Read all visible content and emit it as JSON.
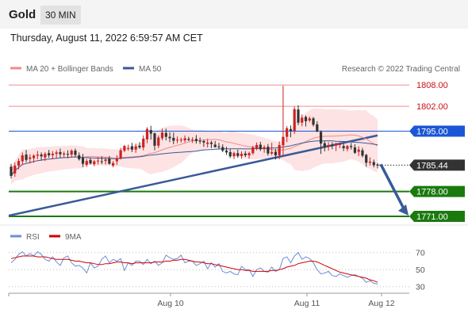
{
  "header": {
    "symbol": "Gold",
    "timeframe": "30 MIN",
    "timestamp": "Thursday, August 11, 2022 6:59:57 AM CET"
  },
  "legend": {
    "ma20_label": "MA 20 + Bollinger Bands",
    "ma50_label": "MA 50",
    "copyright": "Research © 2022 Trading Central",
    "rsi_label": "RSI",
    "rsi_ma_label": "9MA"
  },
  "colors": {
    "candle_up": "#cc2222",
    "candle_down": "#333333",
    "resistance": "#f08c8c",
    "pivot": "#1a56d6",
    "support": "#1a7a0e",
    "trend": "#3a5a98",
    "band_fill": "#fde3e3",
    "ma20": "#f08c8c",
    "ma50": "#3a5a98",
    "rsi": "#6a8fd8",
    "rsi_ma": "#d00000"
  },
  "chart_data": [
    {
      "type": "candlestick",
      "title": "Gold",
      "timeframe": "30 MIN",
      "ylim": [
        1769,
        1810.5
      ],
      "x_ticks": [
        "Aug 10",
        "Aug 11",
        "Aug 12"
      ],
      "last_price": 1785.44,
      "levels": [
        {
          "value": 1808.0,
          "label": "1808.00",
          "kind": "resistance"
        },
        {
          "value": 1802.0,
          "label": "1802.00",
          "kind": "resistance"
        },
        {
          "value": 1795.0,
          "label": "1795.00",
          "kind": "pivot"
        },
        {
          "value": 1785.44,
          "label": "1785.44",
          "kind": "last"
        },
        {
          "value": 1778.0,
          "label": "1778.00",
          "kind": "support"
        },
        {
          "value": 1771.0,
          "label": "1771.00",
          "kind": "support"
        }
      ],
      "trendline": [
        [
          0,
          1771.2
        ],
        [
          97,
          1793.8
        ]
      ],
      "forecast_target": 1771.0,
      "candles": [
        [
          1785.0,
          1785.8,
          1781.7,
          1782.4
        ],
        [
          1783.1,
          1786.2,
          1782.1,
          1785.3
        ],
        [
          1785.3,
          1787.3,
          1784.2,
          1786.6
        ],
        [
          1786.5,
          1789.0,
          1785.6,
          1788.2
        ],
        [
          1788.4,
          1789.7,
          1786.2,
          1786.9
        ],
        [
          1787.2,
          1788.5,
          1785.9,
          1787.6
        ],
        [
          1787.4,
          1788.5,
          1786.1,
          1788.1
        ],
        [
          1788.1,
          1789.4,
          1787.1,
          1788.4
        ],
        [
          1788.4,
          1789.0,
          1786.8,
          1787.9
        ],
        [
          1787.6,
          1789.1,
          1786.6,
          1788.6
        ],
        [
          1788.8,
          1789.7,
          1787.5,
          1788.2
        ],
        [
          1788.2,
          1789.4,
          1787.1,
          1788.6
        ],
        [
          1788.6,
          1789.6,
          1787.5,
          1789.0
        ],
        [
          1789.1,
          1790.1,
          1787.6,
          1788.5
        ],
        [
          1788.4,
          1789.3,
          1787.5,
          1788.7
        ],
        [
          1788.6,
          1789.6,
          1787.4,
          1788.4
        ],
        [
          1788.4,
          1789.9,
          1787.6,
          1789.5
        ],
        [
          1789.5,
          1790.1,
          1787.8,
          1788.3
        ],
        [
          1788.2,
          1789.0,
          1786.7,
          1787.1
        ],
        [
          1787.5,
          1788.6,
          1784.9,
          1785.8
        ],
        [
          1785.5,
          1787.2,
          1784.9,
          1786.6
        ],
        [
          1786.9,
          1787.5,
          1785.6,
          1785.9
        ],
        [
          1785.7,
          1786.9,
          1785.1,
          1786.5
        ],
        [
          1786.7,
          1787.7,
          1785.6,
          1786.7
        ],
        [
          1786.5,
          1787.9,
          1785.7,
          1786.4
        ],
        [
          1786.6,
          1787.6,
          1785.6,
          1787.0
        ],
        [
          1787.2,
          1788.0,
          1785.6,
          1785.8
        ],
        [
          1785.3,
          1786.6,
          1784.8,
          1786.0
        ],
        [
          1786.5,
          1788.2,
          1785.5,
          1787.2
        ],
        [
          1787.4,
          1790.3,
          1787.0,
          1789.6
        ],
        [
          1789.5,
          1791.1,
          1789.1,
          1790.8
        ],
        [
          1790.2,
          1791.2,
          1789.5,
          1790.2
        ],
        [
          1790.7,
          1791.7,
          1789.1,
          1789.8
        ],
        [
          1789.8,
          1791.5,
          1788.9,
          1790.7
        ],
        [
          1790.9,
          1791.9,
          1790.0,
          1790.4
        ],
        [
          1790.4,
          1793.8,
          1789.6,
          1792.9
        ],
        [
          1792.7,
          1796.1,
          1791.6,
          1795.6
        ],
        [
          1795.3,
          1796.5,
          1792.6,
          1794.3
        ],
        [
          1794.4,
          1794.6,
          1789.6,
          1790.9
        ],
        [
          1790.9,
          1793.8,
          1790.2,
          1793.2
        ],
        [
          1793.0,
          1795.7,
          1792.4,
          1794.6
        ],
        [
          1794.5,
          1795.7,
          1792.4,
          1793.4
        ],
        [
          1793.4,
          1794.7,
          1791.9,
          1793.0
        ],
        [
          1793.1,
          1794.6,
          1791.3,
          1792.3
        ],
        [
          1792.5,
          1793.5,
          1791.6,
          1792.6
        ],
        [
          1792.6,
          1793.2,
          1791.8,
          1792.6
        ],
        [
          1792.4,
          1793.8,
          1791.8,
          1793.0
        ],
        [
          1792.8,
          1793.4,
          1792.2,
          1792.5
        ],
        [
          1792.6,
          1793.3,
          1791.7,
          1792.6
        ],
        [
          1792.8,
          1793.9,
          1791.5,
          1792.2
        ],
        [
          1792.3,
          1793.2,
          1791.4,
          1792.1
        ],
        [
          1792.2,
          1792.6,
          1790.6,
          1791.8
        ],
        [
          1791.4,
          1792.8,
          1790.4,
          1791.8
        ],
        [
          1791.8,
          1792.3,
          1790.2,
          1791.4
        ],
        [
          1791.2,
          1792.2,
          1790.4,
          1790.5
        ],
        [
          1790.7,
          1791.7,
          1789.9,
          1790.6
        ],
        [
          1790.5,
          1791.3,
          1789.1,
          1789.5
        ],
        [
          1789.5,
          1790.6,
          1788.3,
          1789.0
        ],
        [
          1789.1,
          1790.0,
          1787.4,
          1787.9
        ],
        [
          1787.9,
          1789.2,
          1787.1,
          1788.8
        ],
        [
          1788.8,
          1789.8,
          1787.5,
          1788.0
        ],
        [
          1788.0,
          1789.3,
          1787.2,
          1788.6
        ],
        [
          1788.7,
          1789.4,
          1787.7,
          1788.2
        ],
        [
          1788.2,
          1789.2,
          1787.3,
          1788.8
        ],
        [
          1788.8,
          1790.9,
          1788.3,
          1790.4
        ],
        [
          1790.2,
          1791.8,
          1789.6,
          1791.1
        ],
        [
          1791.2,
          1792.0,
          1789.4,
          1789.9
        ],
        [
          1789.9,
          1791.0,
          1788.9,
          1790.5
        ],
        [
          1790.6,
          1791.4,
          1788.1,
          1788.7
        ],
        [
          1788.7,
          1791.7,
          1788.2,
          1789.1
        ],
        [
          1789.2,
          1790.0,
          1787.0,
          1788.2
        ],
        [
          1788.2,
          1792.1,
          1787.1,
          1791.1
        ],
        [
          1791.0,
          1807.8,
          1788.2,
          1793.4
        ],
        [
          1793.4,
          1796.4,
          1791.9,
          1795.8
        ],
        [
          1795.6,
          1796.6,
          1793.3,
          1795.0
        ],
        [
          1795.1,
          1801.9,
          1794.2,
          1801.2
        ],
        [
          1801.1,
          1802.3,
          1796.7,
          1797.4
        ],
        [
          1797.4,
          1799.7,
          1796.4,
          1798.8
        ],
        [
          1799.0,
          1799.4,
          1796.3,
          1797.8
        ],
        [
          1798.0,
          1799.1,
          1797.5,
          1798.6
        ],
        [
          1798.6,
          1799.0,
          1796.3,
          1796.8
        ],
        [
          1796.9,
          1797.8,
          1794.7,
          1794.9
        ],
        [
          1794.8,
          1795.2,
          1788.6,
          1791.5
        ],
        [
          1791.6,
          1792.2,
          1789.3,
          1790.6
        ],
        [
          1790.6,
          1791.9,
          1789.5,
          1791.1
        ],
        [
          1791.2,
          1791.9,
          1789.9,
          1790.8
        ],
        [
          1790.9,
          1791.8,
          1789.4,
          1791.4
        ],
        [
          1791.1,
          1791.9,
          1790.2,
          1791.4
        ],
        [
          1790.8,
          1791.5,
          1789.4,
          1790.2
        ],
        [
          1790.0,
          1791.1,
          1789.3,
          1790.8
        ],
        [
          1790.8,
          1791.7,
          1789.8,
          1790.5
        ],
        [
          1790.4,
          1791.3,
          1788.6,
          1788.9
        ],
        [
          1789.2,
          1790.7,
          1788.0,
          1789.8
        ],
        [
          1789.6,
          1790.3,
          1787.6,
          1788.1
        ],
        [
          1788.3,
          1788.6,
          1785.0,
          1786.1
        ],
        [
          1786.1,
          1787.6,
          1785.3,
          1786.4
        ],
        [
          1786.3,
          1787.0,
          1784.8,
          1785.4
        ],
        [
          1785.6,
          1786.0,
          1784.5,
          1785.3
        ]
      ]
    },
    {
      "type": "line",
      "title": "RSI",
      "ylim": [
        26,
        80
      ],
      "y_ticks": [
        70,
        50,
        30
      ],
      "series": [
        {
          "name": "RSI",
          "values": [
            58,
            62,
            68,
            71,
            66,
            69,
            66,
            71,
            68,
            62,
            60,
            65,
            59,
            55,
            64,
            66,
            58,
            54,
            55,
            52,
            46,
            58,
            52,
            54,
            62,
            66,
            58,
            62,
            60,
            63,
            49,
            58,
            55,
            60,
            60,
            56,
            62,
            57,
            60,
            55,
            58,
            67,
            64,
            62,
            63,
            67,
            58,
            60,
            60,
            55,
            57,
            60,
            51,
            58,
            53,
            57,
            48,
            46,
            48,
            45,
            44,
            54,
            50,
            50,
            42,
            50,
            52,
            48,
            47,
            53,
            48,
            50,
            63,
            65,
            58,
            66,
            70,
            62,
            65,
            63,
            58,
            50,
            45,
            46,
            48,
            43,
            42,
            45,
            43,
            41,
            43,
            44,
            42,
            40,
            35,
            37,
            34,
            33
          ]
        },
        {
          "name": "9MA",
          "values": [
            63,
            64,
            65,
            66,
            66,
            66,
            66,
            65,
            65,
            65,
            64,
            63,
            62,
            62,
            62,
            62,
            61,
            60,
            60,
            59,
            58,
            58,
            57,
            56,
            56,
            57,
            57,
            58,
            59,
            59,
            58,
            58,
            57,
            58,
            58,
            58,
            58,
            58,
            59,
            59,
            59,
            60,
            60,
            61,
            61,
            62,
            62,
            61,
            60,
            59,
            59,
            58,
            57,
            57,
            56,
            55,
            54,
            53,
            52,
            51,
            50,
            50,
            49,
            49,
            48,
            48,
            48,
            48,
            48,
            49,
            49,
            50,
            51,
            53,
            54,
            55,
            57,
            58,
            59,
            60,
            60,
            59,
            57,
            55,
            53,
            51,
            49,
            47,
            46,
            45,
            44,
            43,
            42,
            41,
            40,
            38,
            37,
            35
          ]
        }
      ]
    }
  ]
}
